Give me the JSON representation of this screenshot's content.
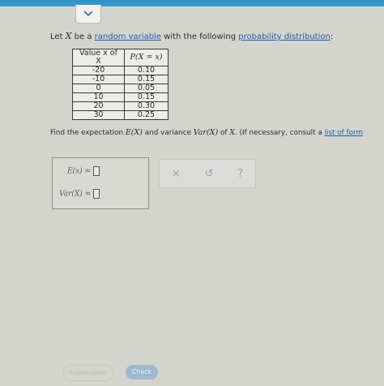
{
  "intro": {
    "prefix": "Let ",
    "variable": "X",
    "middle": " be a ",
    "link1": "random variable",
    "connector": " with the following ",
    "link2": "probability distribution",
    "suffix": ":"
  },
  "table": {
    "header_x": "Value x of X",
    "header_p": "P(X = x)",
    "rows": [
      {
        "x": "-20",
        "p": "0.10"
      },
      {
        "x": "-10",
        "p": "0.15"
      },
      {
        "x": "0",
        "p": "0.05"
      },
      {
        "x": "10",
        "p": "0.15"
      },
      {
        "x": "20",
        "p": "0.30"
      },
      {
        "x": "30",
        "p": "0.25"
      }
    ]
  },
  "question": {
    "prefix": "Find the expectation ",
    "ex": "E(X)",
    "and": " and variance ",
    "varx": "Var(X)",
    "of": " of ",
    "x": "X",
    "rest": ". (If necessary, consult a ",
    "link": "list of form"
  },
  "answers": {
    "expectation_label": "E(x) =",
    "variance_label": "Var(X) ="
  },
  "actions": {
    "clear": "×",
    "undo": "↺",
    "help": "?"
  },
  "buttons": {
    "explanation": "Explanation",
    "check": "Check"
  }
}
